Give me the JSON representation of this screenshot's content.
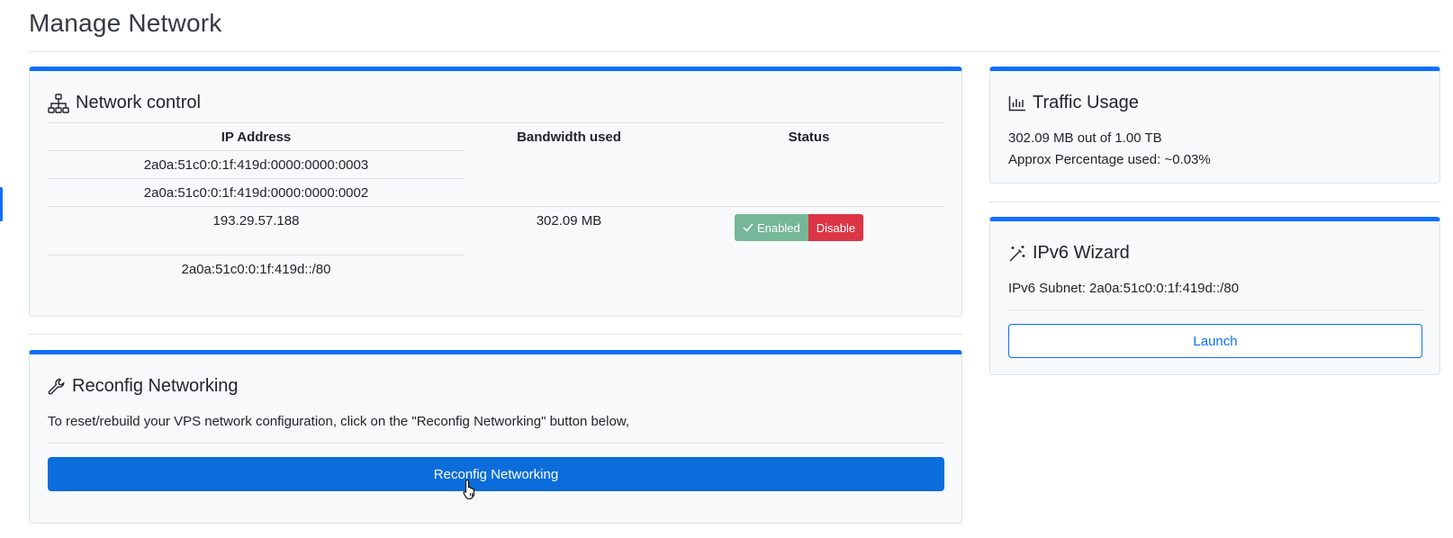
{
  "page": {
    "title": "Manage Network"
  },
  "network_control": {
    "title": "Network control",
    "icon": "sitemap-icon",
    "columns": [
      "IP Address",
      "Bandwidth used",
      "Status"
    ],
    "ipv6_addresses": [
      "2a0a:51c0:0:1f:419d:0000:0000:0003",
      "2a0a:51c0:0:1f:419d:0000:0000:0002"
    ],
    "ipv4_address": "193.29.57.188",
    "bandwidth_used": "302.09 MB",
    "status_enabled": "Enabled",
    "status_disable": "Disable",
    "subnet": "2a0a:51c0:0:1f:419d::/80"
  },
  "reconfig": {
    "title": "Reconfig Networking",
    "icon": "wrench-icon",
    "description": "To reset/rebuild your VPS network configuration, click on the \"Reconfig Networking\" button below,",
    "button_label": "Reconfig Networking"
  },
  "traffic": {
    "title": "Traffic Usage",
    "icon": "bar-chart-icon",
    "usage_text": "302.09 MB out of 1.00 TB",
    "percentage_text": "Approx Percentage used: ~0.03%"
  },
  "ipv6_wizard": {
    "title": "IPv6 Wizard",
    "icon": "magic-wand-icon",
    "subnet_text": "IPv6 Subnet: 2a0a:51c0:0:1f:419d::/80",
    "button_label": "Launch"
  },
  "colors": {
    "primary": "#0d6efd",
    "success": "#75b798",
    "danger": "#dc3545"
  }
}
